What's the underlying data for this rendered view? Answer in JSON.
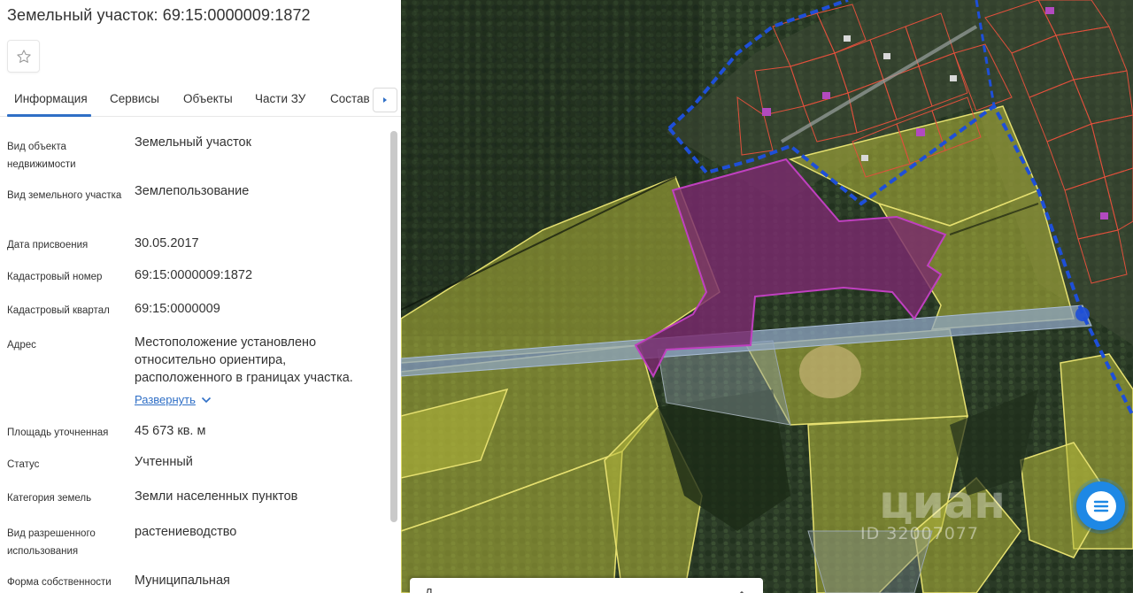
{
  "panel": {
    "title": "Земельный участок: 69:15:0000009:1872",
    "favorite_icon": "star-outline-icon",
    "tabs": [
      {
        "label": "Информация",
        "active": true
      },
      {
        "label": "Сервисы"
      },
      {
        "label": "Объекты"
      },
      {
        "label": "Части ЗУ"
      },
      {
        "label": "Состав"
      }
    ],
    "tabs_next_icon": "caret-right-icon",
    "fields": [
      {
        "key": "Вид объекта недвижимости",
        "value": "Земельный участок"
      },
      {
        "key": "Вид земельного участка",
        "value": "Землепользование"
      },
      {
        "key": "Дата присвоения",
        "value": "30.05.2017"
      },
      {
        "key": "Кадастровый номер",
        "value": "69:15:0000009:1872"
      },
      {
        "key": "Кадастровый квартал",
        "value": "69:15:0000009"
      },
      {
        "key": "Адрес",
        "value": "Местоположение установлено относительно ориентира, расположенного в границах участка."
      },
      {
        "key": "Площадь уточненная",
        "value": "45 673 кв. м"
      },
      {
        "key": "Статус",
        "value": "Учтенный"
      },
      {
        "key": "Категория земель",
        "value": "Земли населенных пунктов"
      },
      {
        "key": "Вид разрешенного использования",
        "value": "растениеводство"
      },
      {
        "key": "Форма собственности",
        "value": "Муниципальная"
      }
    ],
    "expand_label": "Развернуть",
    "expand_icon": "chevron-down-icon"
  },
  "map": {
    "watermark_brand": "циан",
    "watermark_id": "ID 32007077",
    "chat_icon": "chat-lines-icon",
    "bottom_card_text": "Д",
    "bottom_card_icon": "chevron-up-icon",
    "colors": {
      "selected_parcel": "#7a2a6e",
      "parcel_fill": "#b5b83a",
      "parcel_border": "#e6e070",
      "road": "#8fa6c4",
      "boundary_dashed": "#1e4fd8",
      "house_parcel": "#e0503c",
      "accent": "#1e88e5"
    }
  }
}
